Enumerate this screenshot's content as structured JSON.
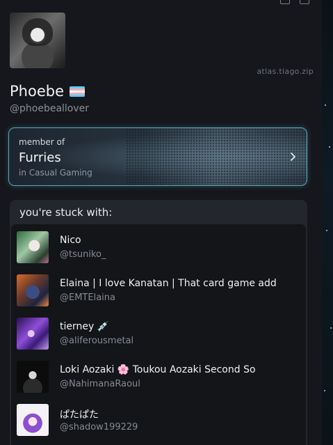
{
  "profile": {
    "site": "atlas.tiago.zip",
    "display_name": "Phoebe",
    "flag_icon": "transgender-flag-icon",
    "handle": "@phoebeallover"
  },
  "member_card": {
    "member_of": "member of",
    "group": "Furries",
    "context": "in Casual Gaming",
    "accent": "#58a9b8"
  },
  "stuck": {
    "title": "you're stuck with:",
    "users": [
      {
        "name": "Nico",
        "handle": "@tsuniko_"
      },
      {
        "name": "Elaina | I love Kanatan | That card game add",
        "handle": "@EMTElaina"
      },
      {
        "name": "tierney 💉",
        "handle": "@aliferousmetal"
      },
      {
        "name": "Loki Aozaki 🌸 Toukou Aozaki Second So",
        "handle": "@NahimanaRaoul"
      },
      {
        "name": "ぱたぱた",
        "handle": "@shadow199229"
      }
    ]
  }
}
